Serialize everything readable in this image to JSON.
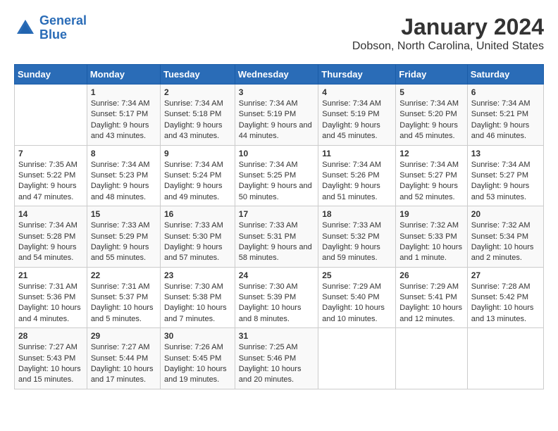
{
  "header": {
    "logo_general": "General",
    "logo_blue": "Blue",
    "title": "January 2024",
    "subtitle": "Dobson, North Carolina, United States"
  },
  "weekdays": [
    "Sunday",
    "Monday",
    "Tuesday",
    "Wednesday",
    "Thursday",
    "Friday",
    "Saturday"
  ],
  "weeks": [
    [
      {
        "day": "",
        "sunrise": "",
        "sunset": "",
        "daylight": ""
      },
      {
        "day": "1",
        "sunrise": "Sunrise: 7:34 AM",
        "sunset": "Sunset: 5:17 PM",
        "daylight": "Daylight: 9 hours and 43 minutes."
      },
      {
        "day": "2",
        "sunrise": "Sunrise: 7:34 AM",
        "sunset": "Sunset: 5:18 PM",
        "daylight": "Daylight: 9 hours and 43 minutes."
      },
      {
        "day": "3",
        "sunrise": "Sunrise: 7:34 AM",
        "sunset": "Sunset: 5:19 PM",
        "daylight": "Daylight: 9 hours and 44 minutes."
      },
      {
        "day": "4",
        "sunrise": "Sunrise: 7:34 AM",
        "sunset": "Sunset: 5:19 PM",
        "daylight": "Daylight: 9 hours and 45 minutes."
      },
      {
        "day": "5",
        "sunrise": "Sunrise: 7:34 AM",
        "sunset": "Sunset: 5:20 PM",
        "daylight": "Daylight: 9 hours and 45 minutes."
      },
      {
        "day": "6",
        "sunrise": "Sunrise: 7:34 AM",
        "sunset": "Sunset: 5:21 PM",
        "daylight": "Daylight: 9 hours and 46 minutes."
      }
    ],
    [
      {
        "day": "7",
        "sunrise": "Sunrise: 7:35 AM",
        "sunset": "Sunset: 5:22 PM",
        "daylight": "Daylight: 9 hours and 47 minutes."
      },
      {
        "day": "8",
        "sunrise": "Sunrise: 7:34 AM",
        "sunset": "Sunset: 5:23 PM",
        "daylight": "Daylight: 9 hours and 48 minutes."
      },
      {
        "day": "9",
        "sunrise": "Sunrise: 7:34 AM",
        "sunset": "Sunset: 5:24 PM",
        "daylight": "Daylight: 9 hours and 49 minutes."
      },
      {
        "day": "10",
        "sunrise": "Sunrise: 7:34 AM",
        "sunset": "Sunset: 5:25 PM",
        "daylight": "Daylight: 9 hours and 50 minutes."
      },
      {
        "day": "11",
        "sunrise": "Sunrise: 7:34 AM",
        "sunset": "Sunset: 5:26 PM",
        "daylight": "Daylight: 9 hours and 51 minutes."
      },
      {
        "day": "12",
        "sunrise": "Sunrise: 7:34 AM",
        "sunset": "Sunset: 5:27 PM",
        "daylight": "Daylight: 9 hours and 52 minutes."
      },
      {
        "day": "13",
        "sunrise": "Sunrise: 7:34 AM",
        "sunset": "Sunset: 5:27 PM",
        "daylight": "Daylight: 9 hours and 53 minutes."
      }
    ],
    [
      {
        "day": "14",
        "sunrise": "Sunrise: 7:34 AM",
        "sunset": "Sunset: 5:28 PM",
        "daylight": "Daylight: 9 hours and 54 minutes."
      },
      {
        "day": "15",
        "sunrise": "Sunrise: 7:33 AM",
        "sunset": "Sunset: 5:29 PM",
        "daylight": "Daylight: 9 hours and 55 minutes."
      },
      {
        "day": "16",
        "sunrise": "Sunrise: 7:33 AM",
        "sunset": "Sunset: 5:30 PM",
        "daylight": "Daylight: 9 hours and 57 minutes."
      },
      {
        "day": "17",
        "sunrise": "Sunrise: 7:33 AM",
        "sunset": "Sunset: 5:31 PM",
        "daylight": "Daylight: 9 hours and 58 minutes."
      },
      {
        "day": "18",
        "sunrise": "Sunrise: 7:33 AM",
        "sunset": "Sunset: 5:32 PM",
        "daylight": "Daylight: 9 hours and 59 minutes."
      },
      {
        "day": "19",
        "sunrise": "Sunrise: 7:32 AM",
        "sunset": "Sunset: 5:33 PM",
        "daylight": "Daylight: 10 hours and 1 minute."
      },
      {
        "day": "20",
        "sunrise": "Sunrise: 7:32 AM",
        "sunset": "Sunset: 5:34 PM",
        "daylight": "Daylight: 10 hours and 2 minutes."
      }
    ],
    [
      {
        "day": "21",
        "sunrise": "Sunrise: 7:31 AM",
        "sunset": "Sunset: 5:36 PM",
        "daylight": "Daylight: 10 hours and 4 minutes."
      },
      {
        "day": "22",
        "sunrise": "Sunrise: 7:31 AM",
        "sunset": "Sunset: 5:37 PM",
        "daylight": "Daylight: 10 hours and 5 minutes."
      },
      {
        "day": "23",
        "sunrise": "Sunrise: 7:30 AM",
        "sunset": "Sunset: 5:38 PM",
        "daylight": "Daylight: 10 hours and 7 minutes."
      },
      {
        "day": "24",
        "sunrise": "Sunrise: 7:30 AM",
        "sunset": "Sunset: 5:39 PM",
        "daylight": "Daylight: 10 hours and 8 minutes."
      },
      {
        "day": "25",
        "sunrise": "Sunrise: 7:29 AM",
        "sunset": "Sunset: 5:40 PM",
        "daylight": "Daylight: 10 hours and 10 minutes."
      },
      {
        "day": "26",
        "sunrise": "Sunrise: 7:29 AM",
        "sunset": "Sunset: 5:41 PM",
        "daylight": "Daylight: 10 hours and 12 minutes."
      },
      {
        "day": "27",
        "sunrise": "Sunrise: 7:28 AM",
        "sunset": "Sunset: 5:42 PM",
        "daylight": "Daylight: 10 hours and 13 minutes."
      }
    ],
    [
      {
        "day": "28",
        "sunrise": "Sunrise: 7:27 AM",
        "sunset": "Sunset: 5:43 PM",
        "daylight": "Daylight: 10 hours and 15 minutes."
      },
      {
        "day": "29",
        "sunrise": "Sunrise: 7:27 AM",
        "sunset": "Sunset: 5:44 PM",
        "daylight": "Daylight: 10 hours and 17 minutes."
      },
      {
        "day": "30",
        "sunrise": "Sunrise: 7:26 AM",
        "sunset": "Sunset: 5:45 PM",
        "daylight": "Daylight: 10 hours and 19 minutes."
      },
      {
        "day": "31",
        "sunrise": "Sunrise: 7:25 AM",
        "sunset": "Sunset: 5:46 PM",
        "daylight": "Daylight: 10 hours and 20 minutes."
      },
      {
        "day": "",
        "sunrise": "",
        "sunset": "",
        "daylight": ""
      },
      {
        "day": "",
        "sunrise": "",
        "sunset": "",
        "daylight": ""
      },
      {
        "day": "",
        "sunrise": "",
        "sunset": "",
        "daylight": ""
      }
    ]
  ]
}
